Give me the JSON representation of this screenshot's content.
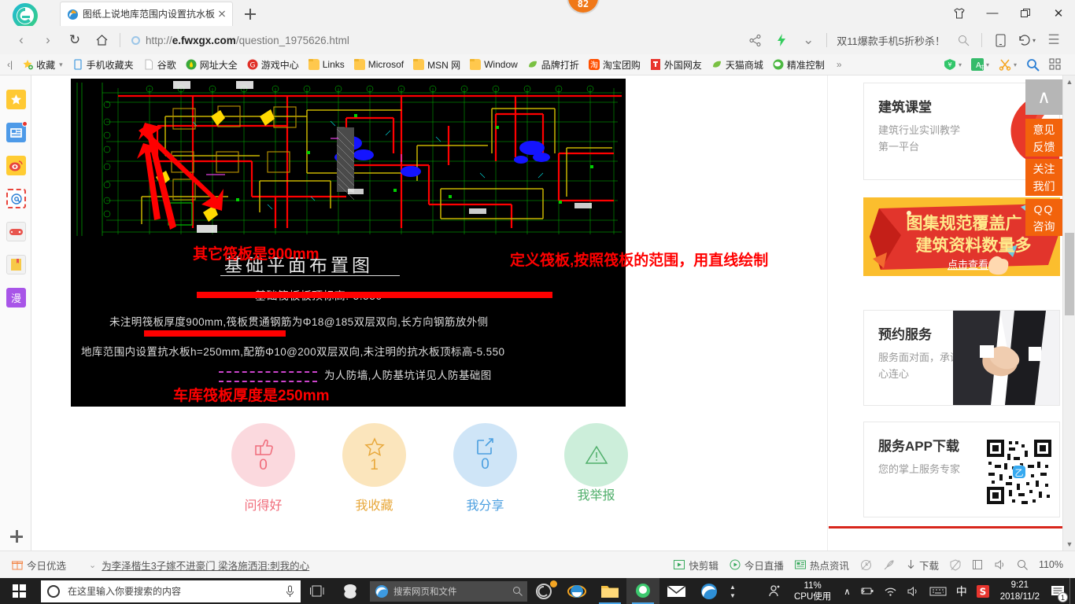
{
  "browser": {
    "tab": {
      "title": "图纸上说地库范围内设置抗水板",
      "favicon": "edge-favicon",
      "close": "close-icon"
    },
    "newtab_label": "+",
    "badge": "82",
    "window_buttons": [
      {
        "name": "shirt-skin-button",
        "glyph": "\u0000"
      },
      {
        "name": "minimize-button",
        "glyph": "—"
      },
      {
        "name": "maximize-button",
        "glyph": "❐"
      },
      {
        "name": "close-window-button",
        "glyph": "✕"
      }
    ],
    "nav": {
      "back": "‹",
      "forward": "›",
      "reload": "↻",
      "home": "⌂",
      "url_prefix": "http://",
      "url_domain": "e.fwxgx.com",
      "url_path": "/question_1975626.html",
      "share": "share-icon",
      "lightning": "lightning-icon",
      "chevron": "⌄",
      "promo_text": "双11爆款手机5折秒杀！",
      "search": "search-icon",
      "mobile": "mobile-icon",
      "history": "↶",
      "menu": "☰"
    },
    "bookmarks": {
      "collapse": "‹|",
      "items": [
        {
          "label": "收藏",
          "icon": "star-folder-icon",
          "caret": "⌄"
        },
        {
          "label": "手机收藏夹",
          "icon": "phone-icon"
        },
        {
          "label": "谷歌",
          "icon": "page-icon"
        },
        {
          "label": "网址大全",
          "icon": "green-circle-icon"
        },
        {
          "label": "游戏中心",
          "icon": "red-circle-icon"
        },
        {
          "label": "Links",
          "icon": "folder-icon"
        },
        {
          "label": "Microsof",
          "icon": "folder-icon"
        },
        {
          "label": "MSN 网",
          "icon": "folder-icon"
        },
        {
          "label": "Window",
          "icon": "folder-icon"
        },
        {
          "label": "品牌打折",
          "icon": "leaf-icon"
        },
        {
          "label": "淘宝团购",
          "icon": "taobao-icon"
        },
        {
          "label": "外国网友",
          "icon": "red-square-icon"
        },
        {
          "label": "天猫商城",
          "icon": "leaf-icon"
        },
        {
          "label": "精准控制",
          "icon": "wechat-icon"
        }
      ],
      "overflow": "»",
      "right_tools": [
        {
          "name": "coupon-icon",
          "glyph": "¥"
        },
        {
          "name": "translate-icon",
          "glyph": "A"
        },
        {
          "name": "scissors-icon",
          "glyph": "✂"
        },
        {
          "name": "magnifier-icon",
          "glyph": "search"
        },
        {
          "name": "apps-grid-icon",
          "glyph": "grid"
        }
      ]
    },
    "status_bar": {
      "left": [
        {
          "label": "今日优选",
          "icon": "gift-icon"
        },
        {
          "label": "为李泽楷生3子嫁不进豪门 梁洛施洒泪:刺我的心",
          "icon": "chevron-double-down-icon"
        }
      ],
      "right": [
        {
          "label": "快剪辑",
          "icon": "video-edit-icon"
        },
        {
          "label": "今日直播",
          "icon": "live-play-icon"
        },
        {
          "label": "热点资讯",
          "icon": "news-icon"
        },
        {
          "label": "",
          "icon": "clock-off-icon"
        },
        {
          "label": "",
          "icon": "mute-rocket-icon"
        },
        {
          "label": "下载",
          "icon": "download-icon"
        },
        {
          "label": "",
          "icon": "shield-off-icon"
        },
        {
          "label": "",
          "icon": "window-icon"
        },
        {
          "label": "",
          "icon": "speaker-icon"
        },
        {
          "label": "",
          "icon": "zoom-search-icon"
        },
        {
          "label": "110%",
          "icon": "zoom-level"
        }
      ]
    }
  },
  "left_rail": {
    "items": [
      {
        "name": "favorites-star-icon",
        "glyph": "★",
        "bg": "#ffc933",
        "fg": "#ffffff"
      },
      {
        "name": "news-feed-icon",
        "glyph": "☷",
        "bg": "#4d9ae8",
        "fg": "#ffffff",
        "dot": true
      },
      {
        "name": "weibo-icon",
        "glyph": "◉",
        "bg": "#ffcc33",
        "fg": "#e8453c"
      },
      {
        "name": "mail-at-icon",
        "glyph": "@",
        "bg": "#ffffff",
        "fg": "#2b7fd4"
      },
      {
        "name": "game-controller-icon",
        "glyph": "⚇",
        "bg": "#f0f0f0",
        "fg": "#e8554e"
      },
      {
        "name": "bookmark-book-icon",
        "glyph": "▣",
        "bg": "#f0f0f0",
        "fg": "#f0b52e"
      },
      {
        "name": "manga-icon",
        "glyph": "漫",
        "bg": "#a855e8",
        "fg": "#ffffff"
      }
    ],
    "add": "add-panel-icon"
  },
  "cad": {
    "title": "基础平面布置图",
    "notes": [
      "基础筏板板顶标高:-5.550",
      "未注明筏板厚度900mm,筏板贯通钢筋为Φ18@185双层双向,长方向钢筋放外侧",
      "地库范围内设置抗水板h=250mm,配筋Φ10@200双层双向,未注明的抗水板顶标高-5.550",
      "为人防墙,人防基坑详见人防基础图"
    ],
    "annotations": [
      {
        "text": "其它筏板是900mm",
        "name": "annotation-raft-900"
      },
      {
        "text": "定义筏板,按照筏板的范围，用直线绘制",
        "name": "annotation-define-raft"
      },
      {
        "text": "车库筏板厚度是250mm",
        "name": "annotation-garage-250"
      }
    ]
  },
  "actions": [
    {
      "label": "问得好",
      "count": "0",
      "icon": "thumbs-up-icon",
      "color": "#f06b7a",
      "bg": "#fbd9de"
    },
    {
      "label": "我收藏",
      "count": "1",
      "icon": "star-outline-icon",
      "color": "#e8a83c",
      "bg": "#fbe5bc"
    },
    {
      "label": "我分享",
      "count": "0",
      "icon": "share-box-icon",
      "color": "#4b9fe0",
      "bg": "#cfe5f7"
    },
    {
      "label": "我举报",
      "count": "",
      "icon": "warning-triangle-icon",
      "color": "#4fae6a",
      "bg": "#cceeda"
    }
  ],
  "sidebar": {
    "cards": [
      {
        "title": "建筑课堂",
        "desc": "建筑行业实训教学第一平台",
        "art": "flame-logo"
      },
      {
        "title": "预约服务",
        "desc": "服务面对面，承诺心连心",
        "art": "handshake-photo"
      },
      {
        "title": "服务APP下载",
        "desc": "您的掌上服务专家",
        "art": "qr-code"
      }
    ],
    "banner": {
      "line1": "图集规范覆盖广",
      "line2": "建筑资料数量多",
      "cta": "点击查看"
    },
    "float_buttons": [
      {
        "name": "back-to-top-button",
        "label": "∧"
      },
      {
        "name": "feedback-button",
        "label": "意见\n反馈"
      },
      {
        "name": "follow-us-button",
        "label": "关注\n我们"
      },
      {
        "name": "qq-consult-button",
        "label": "QQ\n咨询"
      }
    ]
  },
  "taskbar": {
    "start": "windows-start-icon",
    "search_placeholder": "在这里输入你要搜索的内容",
    "mic": "microphone-icon",
    "taskview": "task-view-icon",
    "apps": [
      {
        "name": "cortana-spiral-icon"
      },
      {
        "name": "edge-search-box",
        "placeholder": "搜索网页和文件"
      },
      {
        "name": "sogou-browser-icon",
        "badge": true
      },
      {
        "name": "internet-explorer-icon"
      },
      {
        "name": "file-explorer-icon"
      },
      {
        "name": "360-browser-icon",
        "active": true
      },
      {
        "name": "mail-icon"
      },
      {
        "name": "edge-browser-icon"
      }
    ],
    "tray": {
      "people": "people-icon",
      "cpu_value": "11%",
      "cpu_label": "CPU使用",
      "chevron": "∧",
      "icons": [
        "battery-icon",
        "wifi-icon",
        "speaker-icon",
        "keyboard-icon"
      ],
      "ime": "中",
      "sogou": "S",
      "time": "9:21",
      "date": "2018/11/2",
      "notifications": "1"
    }
  }
}
